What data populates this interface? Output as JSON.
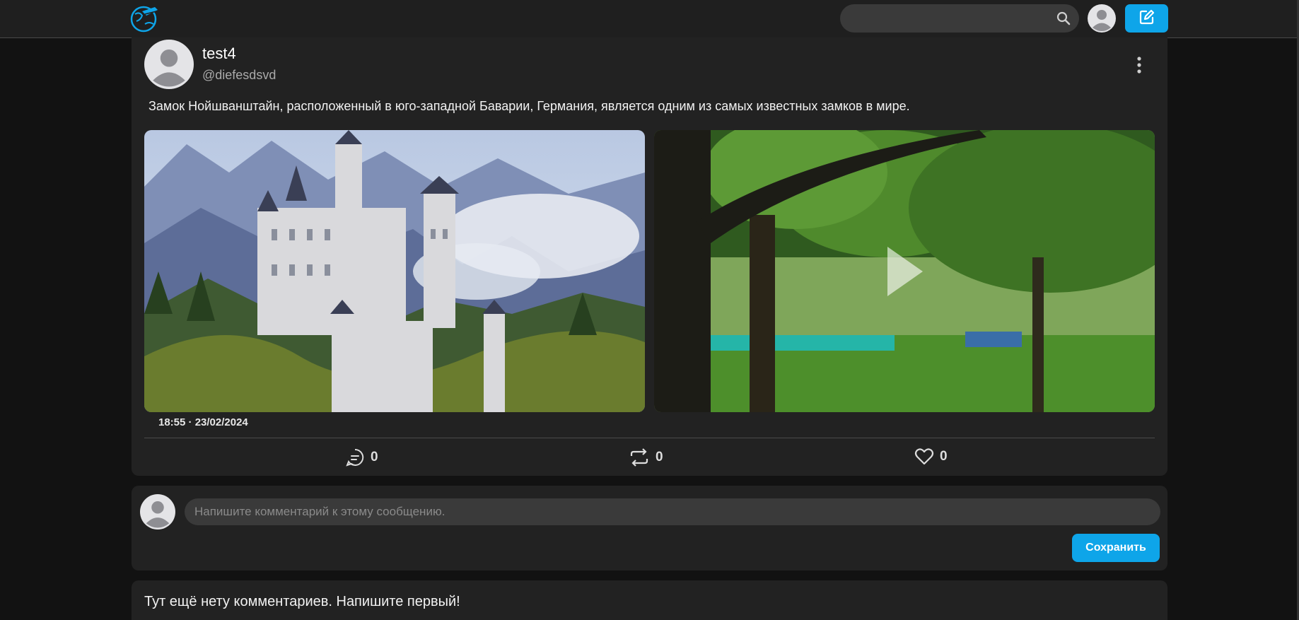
{
  "header": {
    "logo_icon": "globe-hand-logo-icon",
    "search": {
      "value": "",
      "placeholder": ""
    },
    "search_icon": "search-icon",
    "avatar_icon": "user-avatar-icon",
    "compose_icon": "edit-icon"
  },
  "post": {
    "username": "test4",
    "handle": "@diefesdsvd",
    "more_icon": "vertical-dots-icon",
    "text": "Замок Нойшванштайн, расположенный в юго-западной Баварии, Германия, является одним из самых известных замков в мире.",
    "media": [
      {
        "kind": "image",
        "icon": "castle-photo"
      },
      {
        "kind": "video",
        "icon": "play-icon"
      }
    ],
    "timestamp": "18:55 · 23/02/2024",
    "actions": {
      "replies": "0",
      "reposts": "0",
      "likes": "0"
    }
  },
  "comment_form": {
    "placeholder": "Напишите комментарий к этому сообщению.",
    "value": "",
    "save_label": "Сохранить"
  },
  "comments": {
    "empty_text": "Тут ещё нету комментариев. Напишите первый!"
  },
  "colors": {
    "accent": "#0ea5e9",
    "background": "#121212",
    "card": "#222222"
  }
}
